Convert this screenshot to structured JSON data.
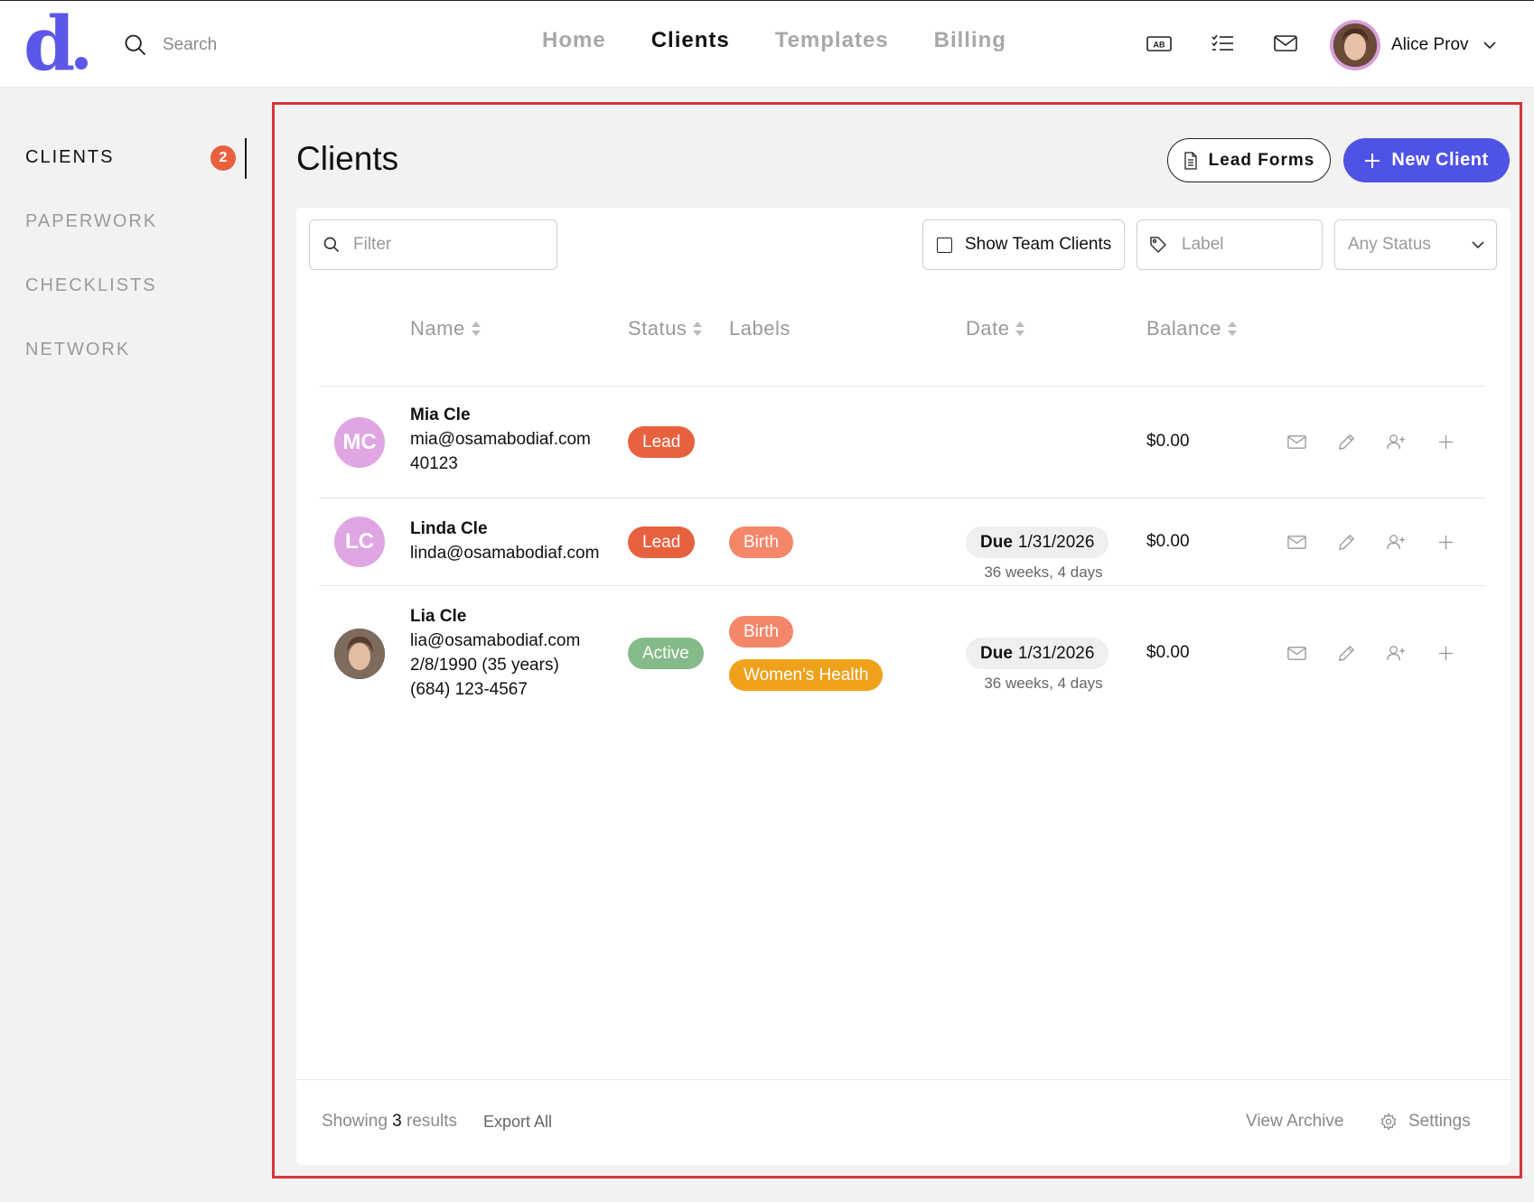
{
  "brand": {
    "logo_text": "d",
    "accent": "#5b57e8"
  },
  "search": {
    "placeholder": "Search"
  },
  "nav": {
    "items": [
      "Home",
      "Clients",
      "Templates",
      "Billing"
    ],
    "active": "Clients"
  },
  "header_icons": {
    "ab_label": "AB",
    "icons": [
      "ab-badge-icon",
      "checklist-icon",
      "mail-icon"
    ]
  },
  "user": {
    "name": "Alice Prov"
  },
  "sidebar": {
    "items": [
      {
        "label": "CLIENTS",
        "active": true,
        "badge": "2"
      },
      {
        "label": "PAPERWORK"
      },
      {
        "label": "CHECKLISTS"
      },
      {
        "label": "NETWORK"
      }
    ]
  },
  "page": {
    "title": "Clients",
    "lead_forms_label": "Lead Forms",
    "new_client_label": "New Client"
  },
  "filters": {
    "filter_placeholder": "Filter",
    "team_clients_label": "Show Team Clients",
    "label_placeholder": "Label",
    "status_value": "Any Status"
  },
  "table": {
    "headers": {
      "name": "Name",
      "status": "Status",
      "labels": "Labels",
      "date": "Date",
      "balance": "Balance"
    },
    "rows": [
      {
        "initials": "MC",
        "name": "Mia Cle",
        "email": "mia@osamabodiaf.com",
        "extra1": "40123",
        "extra2": "",
        "status": "Lead",
        "labels": [],
        "due_label": "",
        "due_date": "",
        "due_sub": "",
        "balance": "$0.00"
      },
      {
        "initials": "LC",
        "name": "Linda Cle",
        "email": "linda@osamabodiaf.com",
        "extra1": "",
        "extra2": "",
        "status": "Lead",
        "labels": [
          "Birth"
        ],
        "due_label": "Due",
        "due_date": "1/31/2026",
        "due_sub": "36 weeks, 4 days",
        "balance": "$0.00"
      },
      {
        "initials": "",
        "name": "Lia Cle",
        "email": "lia@osamabodiaf.com",
        "extra1": "2/8/1990 (35 years)",
        "extra2": "(684) 123-4567",
        "status": "Active",
        "labels": [
          "Birth",
          "Women's Health"
        ],
        "due_label": "Due",
        "due_date": "1/31/2026",
        "due_sub": "36 weeks, 4 days",
        "balance": "$0.00"
      }
    ]
  },
  "footer": {
    "showing_prefix": "Showing",
    "count": "3",
    "showing_suffix": "results",
    "export_label": "Export All",
    "archive_label": "View Archive",
    "settings_label": "Settings"
  },
  "colors": {
    "lead": "#e8613f",
    "active": "#85bb8a",
    "birth": "#f4866a",
    "womens_health": "#f0a11b",
    "primary_button": "#4f53e5",
    "highlight_outline": "#d9343b"
  }
}
